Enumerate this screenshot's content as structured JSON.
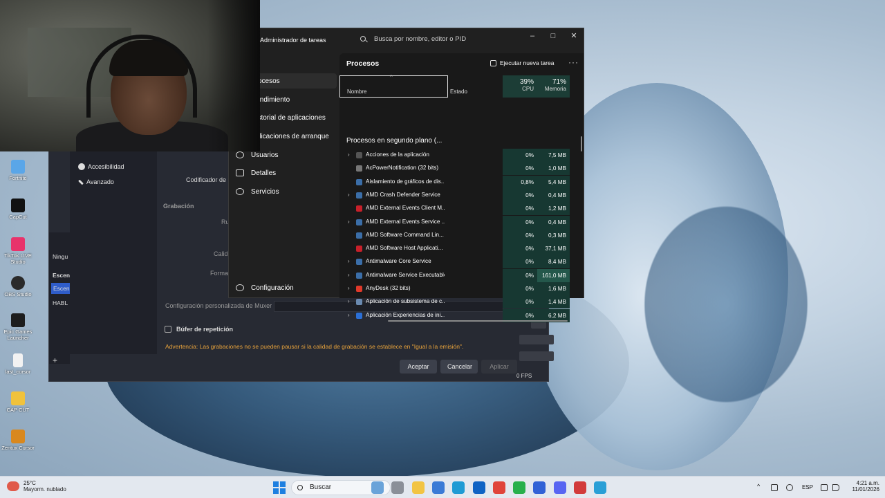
{
  "desktop": {
    "icons": [
      {
        "label": "Fortnite",
        "color": "#5aa6e8"
      },
      {
        "label": "CapCut",
        "color": "#111111"
      },
      {
        "label": "TikTok LIVE Studio",
        "color": "#e8336b"
      },
      {
        "label": "OBS Studio",
        "color": "#2a2a2a"
      },
      {
        "label": "Epic Games Launcher",
        "color": "#1d1d1d"
      },
      {
        "label": "last_cursor",
        "color": "#f2f2f2"
      },
      {
        "label": "CAP CUT",
        "color": "#f0c23c"
      },
      {
        "label": "Zentux Cursor",
        "color": "#d9881e"
      }
    ]
  },
  "obs": {
    "sidebar": [
      {
        "label": "Accesibilidad",
        "icon": "accessibility-icon"
      },
      {
        "label": "Avanzado",
        "icon": "wrench-icon"
      }
    ],
    "codificador_label": "Codificador de",
    "grabacion_header": "Grabación",
    "ru_label": "Ru",
    "calidad_label": "Calid",
    "formato_label": "Forma",
    "muxer_label": "Configuración personalizada de Muxer",
    "buffer_label": "Búfer de repetición",
    "warning": "Advertencia: Las grabaciones no se pueden pausar si la calidad de grabación se establece en \"Igual a la emisión\".",
    "buttons": {
      "accept": "Aceptar",
      "cancel": "Cancelar",
      "apply": "Aplicar"
    },
    "left_panel": {
      "ningu": "Ningu",
      "escen1": "Escen",
      "escen2": "Escen",
      "habl": "HABL"
    },
    "fps": "0 FPS"
  },
  "task_manager": {
    "title": "Administrador de tareas",
    "search_placeholder": "Busca por nombre, editor o PID",
    "nav": [
      {
        "label": "Procesos",
        "icon": "processes-icon",
        "selected": true
      },
      {
        "label": "Rendimiento",
        "icon": "performance-icon"
      },
      {
        "label": "Historial de aplicaciones",
        "icon": "history-icon"
      },
      {
        "label": "Aplicaciones de arranque",
        "icon": "startup-icon"
      },
      {
        "label": "Usuarios",
        "icon": "users-icon"
      },
      {
        "label": "Detalles",
        "icon": "details-icon"
      },
      {
        "label": "Servicios",
        "icon": "services-icon"
      }
    ],
    "settings_label": "Configuración",
    "pane_title": "Procesos",
    "run_task_label": "Ejecutar nueva tarea",
    "columns": {
      "name": "Nombre",
      "status": "Estado",
      "cpu_pct": "39%",
      "cpu_label": "CPU",
      "mem_pct": "71%",
      "mem_label": "Memoria"
    },
    "group_header": "Procesos en segundo plano (...",
    "processes": [
      {
        "name": "Acciones de la aplicación",
        "expandable": true,
        "icon_color": "#555555",
        "cpu": "0%",
        "mem": "7,5 MB"
      },
      {
        "name": "AcPowerNotification (32 bits)",
        "expandable": false,
        "icon_color": "#777777",
        "cpu": "0%",
        "mem": "1,0 MB"
      },
      {
        "name": "Aislamiento de gráficos de dis...",
        "expandable": false,
        "icon_color": "#3b6ea8",
        "cpu": "0,8%",
        "mem": "5,4 MB"
      },
      {
        "name": "AMD Crash Defender Service",
        "expandable": true,
        "icon_color": "#3b6ea8",
        "cpu": "0%",
        "mem": "0,4 MB"
      },
      {
        "name": "AMD External Events Client M...",
        "expandable": false,
        "icon_color": "#c8202a",
        "cpu": "0%",
        "mem": "1,2 MB"
      },
      {
        "name": "AMD External Events Service ...",
        "expandable": true,
        "icon_color": "#3b6ea8",
        "cpu": "0%",
        "mem": "0,4 MB"
      },
      {
        "name": "AMD Software Command Lin...",
        "expandable": false,
        "icon_color": "#3b6ea8",
        "cpu": "0%",
        "mem": "0,3 MB"
      },
      {
        "name": "AMD Software Host Applicati...",
        "expandable": false,
        "icon_color": "#c8202a",
        "cpu": "0%",
        "mem": "37,1 MB"
      },
      {
        "name": "Antimalware Core Service",
        "expandable": true,
        "icon_color": "#3b6ea8",
        "cpu": "0%",
        "mem": "8,4 MB"
      },
      {
        "name": "Antimalware Service Executable",
        "expandable": true,
        "icon_color": "#3b6ea8",
        "cpu": "0%",
        "mem": "161,0 MB",
        "mem_high": true
      },
      {
        "name": "AnyDesk (32 bits)",
        "expandable": true,
        "icon_color": "#e0392a",
        "cpu": "0%",
        "mem": "1,6 MB"
      },
      {
        "name": "Aplicación de subsistema de c...",
        "expandable": true,
        "icon_color": "#6a8ab0",
        "cpu": "0%",
        "mem": "1,4 MB"
      },
      {
        "name": "Aplicación Experiencias de ini...",
        "expandable": true,
        "icon_color": "#2b6fd6",
        "cpu": "0%",
        "mem": "6,2 MB"
      }
    ]
  },
  "taskbar": {
    "weather_temp": "25°C",
    "weather_desc": "Mayorm. nublado",
    "search_label": "Buscar",
    "lang": "ESP",
    "time": "4:21 a.m.",
    "date": "11/01/2026",
    "apps": [
      {
        "name": "widgets-app",
        "color": "#6aa3d9"
      },
      {
        "name": "task-view",
        "color": "#8a8f98"
      },
      {
        "name": "file-explorer",
        "color": "#f2c443"
      },
      {
        "name": "microsoft-store",
        "color": "#3b7bd6"
      },
      {
        "name": "edge",
        "color": "#1f9bd4"
      },
      {
        "name": "outlook",
        "color": "#0f63c4"
      },
      {
        "name": "chrome",
        "color": "#e0443a"
      },
      {
        "name": "whatsapp",
        "color": "#27b04c"
      },
      {
        "name": "app-blue",
        "color": "#3262d6"
      },
      {
        "name": "discord",
        "color": "#5865f2"
      },
      {
        "name": "app-red",
        "color": "#d23b3b"
      },
      {
        "name": "task-manager",
        "color": "#2a9fd6"
      }
    ]
  }
}
